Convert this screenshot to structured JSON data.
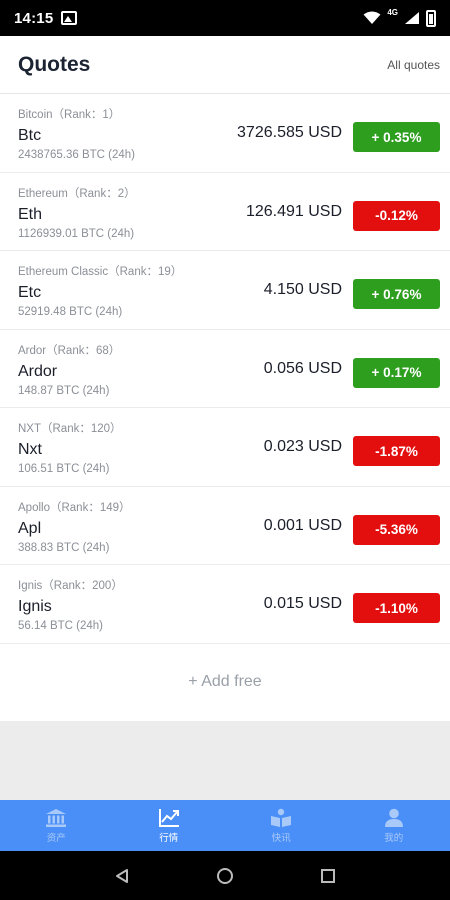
{
  "status": {
    "time": "14:15",
    "network": "4G"
  },
  "header": {
    "title": "Quotes",
    "all_quotes": "All quotes"
  },
  "quotes": [
    {
      "name": "Bitcoin（Rank：1）",
      "symbol": "Btc",
      "volume": "2438765.36 BTC (24h)",
      "price": "3726.585 USD",
      "change": "+ 0.35%",
      "direction": "up"
    },
    {
      "name": "Ethereum（Rank：2）",
      "symbol": "Eth",
      "volume": "1126939.01 BTC (24h)",
      "price": "126.491 USD",
      "change": "-0.12%",
      "direction": "down"
    },
    {
      "name": "Ethereum Classic（Rank：19）",
      "symbol": "Etc",
      "volume": "52919.48 BTC (24h)",
      "price": "4.150 USD",
      "change": "+ 0.76%",
      "direction": "up"
    },
    {
      "name": "Ardor（Rank：68）",
      "symbol": "Ardor",
      "volume": "148.87 BTC (24h)",
      "price": "0.056 USD",
      "change": "+ 0.17%",
      "direction": "up"
    },
    {
      "name": "NXT（Rank：120）",
      "symbol": "Nxt",
      "volume": "106.51 BTC (24h)",
      "price": "0.023 USD",
      "change": "-1.87%",
      "direction": "down"
    },
    {
      "name": "Apollo（Rank：149）",
      "symbol": "Apl",
      "volume": "388.83 BTC (24h)",
      "price": "0.001 USD",
      "change": "-5.36%",
      "direction": "down"
    },
    {
      "name": "Ignis（Rank：200）",
      "symbol": "Ignis",
      "volume": "56.14 BTC (24h)",
      "price": "0.015 USD",
      "change": "-1.10%",
      "direction": "down"
    }
  ],
  "add_free": "+ Add free",
  "colors": {
    "up": "#2e9e1f",
    "down": "#e30e0e",
    "accent": "#4a8ff7"
  },
  "nav": [
    {
      "label": "资产",
      "icon": "bank-icon",
      "active": false
    },
    {
      "label": "行情",
      "icon": "chart-icon",
      "active": true
    },
    {
      "label": "快讯",
      "icon": "book-reader-icon",
      "active": false
    },
    {
      "label": "我的",
      "icon": "user-icon",
      "active": false
    }
  ]
}
